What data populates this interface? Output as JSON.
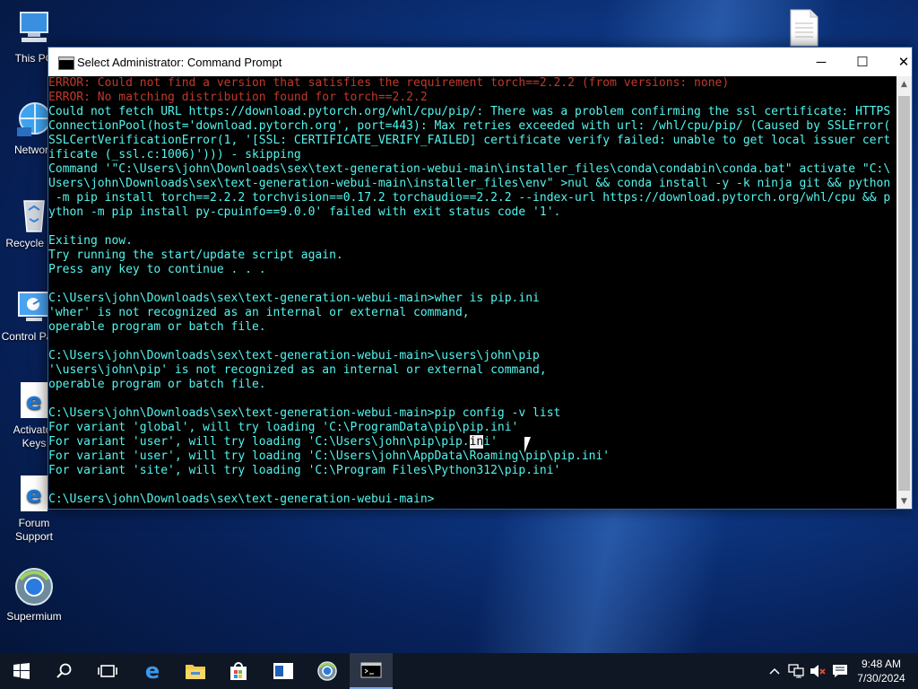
{
  "desktop": {
    "icons": [
      {
        "label": "This PC",
        "icon": "computer-icon"
      },
      {
        "label": "Network",
        "icon": "network-icon"
      },
      {
        "label": "Recycle Bin",
        "icon": "recycle-bin-icon"
      },
      {
        "label": "Control Panel",
        "icon": "control-panel-icon"
      },
      {
        "label": "Activator Keys",
        "icon": "edge-icon"
      },
      {
        "label": "Forum Support",
        "icon": "edge-icon"
      },
      {
        "label": "Supermium",
        "icon": "supermium-icon"
      }
    ],
    "file_icon": "document-icon"
  },
  "window": {
    "title": "Select Administrator: Command Prompt",
    "buttons": {
      "minimize": "─",
      "maximize": "☐",
      "close": "✕"
    },
    "lines": [
      {
        "text": "ERROR: Could not find a version that satisfies the requirement torch==2.2.2 (from versions: none)",
        "type": "err"
      },
      {
        "text": "ERROR: No matching distribution found for torch==2.2.2",
        "type": "err"
      },
      {
        "text": "Could not fetch URL https://download.pytorch.org/whl/cpu/pip/: There was a problem confirming the ssl certificate: HTTPS",
        "type": "out"
      },
      {
        "text": "ConnectionPool(host='download.pytorch.org', port=443): Max retries exceeded with url: /whl/cpu/pip/ (Caused by SSLError(",
        "type": "out"
      },
      {
        "text": "SSLCertVerificationError(1, '[SSL: CERTIFICATE_VERIFY_FAILED] certificate verify failed: unable to get local issuer cert",
        "type": "out"
      },
      {
        "text": "ificate (_ssl.c:1006)'))) - skipping",
        "type": "out"
      },
      {
        "text": "Command '\"C:\\Users\\john\\Downloads\\sex\\text-generation-webui-main\\installer_files\\conda\\condabin\\conda.bat\" activate \"C:\\",
        "type": "out"
      },
      {
        "text": "Users\\john\\Downloads\\sex\\text-generation-webui-main\\installer_files\\env\" >nul && conda install -y -k ninja git && python",
        "type": "out"
      },
      {
        "text": " -m pip install torch==2.2.2 torchvision==0.17.2 torchaudio==2.2.2 --index-url https://download.pytorch.org/whl/cpu && p",
        "type": "out"
      },
      {
        "text": "ython -m pip install py-cpuinfo==9.0.0' failed with exit status code '1'.",
        "type": "out"
      },
      {
        "text": "",
        "type": "out"
      },
      {
        "text": "Exiting now.",
        "type": "out"
      },
      {
        "text": "Try running the start/update script again.",
        "type": "out"
      },
      {
        "text": "Press any key to continue . . .",
        "type": "out"
      },
      {
        "text": "",
        "type": "out"
      },
      {
        "text": "C:\\Users\\john\\Downloads\\sex\\text-generation-webui-main>wher is pip.ini",
        "type": "out"
      },
      {
        "text": "'wher' is not recognized as an internal or external command,",
        "type": "out"
      },
      {
        "text": "operable program or batch file.",
        "type": "out"
      },
      {
        "text": "",
        "type": "out"
      },
      {
        "text": "C:\\Users\\john\\Downloads\\sex\\text-generation-webui-main>\\users\\john\\pip",
        "type": "out"
      },
      {
        "text": "'\\users\\john\\pip' is not recognized as an internal or external command,",
        "type": "out"
      },
      {
        "text": "operable program or batch file.",
        "type": "out"
      },
      {
        "text": "",
        "type": "out"
      },
      {
        "text": "C:\\Users\\john\\Downloads\\sex\\text-generation-webui-main>pip config -v list",
        "type": "out"
      },
      {
        "text": "For variant 'global', will try loading 'C:\\ProgramData\\pip\\pip.ini'",
        "type": "out"
      },
      {
        "text": "For variant 'user', will try loading 'C:\\Users\\john\\pip\\pip.ini'",
        "type": "out",
        "selected": "in"
      },
      {
        "text": "For variant 'user', will try loading 'C:\\Users\\john\\AppData\\Roaming\\pip\\pip.ini'",
        "type": "out"
      },
      {
        "text": "For variant 'site', will try loading 'C:\\Program Files\\Python312\\pip.ini'",
        "type": "out"
      },
      {
        "text": "",
        "type": "out"
      },
      {
        "text": "C:\\Users\\john\\Downloads\\sex\\text-generation-webui-main>",
        "type": "out"
      }
    ]
  },
  "taskbar": {
    "items": [
      "windows-start-icon",
      "search-icon",
      "task-view-icon",
      "edge-icon",
      "file-explorer-icon",
      "store-icon",
      "app-icon",
      "supermium-icon",
      "command-prompt-icon"
    ],
    "tray": [
      "chevron-up-icon",
      "network-icon",
      "volume-muted-icon",
      "notifications-icon"
    ],
    "time": "9:48 AM",
    "date": "7/30/2024"
  },
  "colors": {
    "console_text": "#53f5ee",
    "console_error": "#c0392b",
    "console_bg": "#000000",
    "taskbar": "#0f1724"
  }
}
